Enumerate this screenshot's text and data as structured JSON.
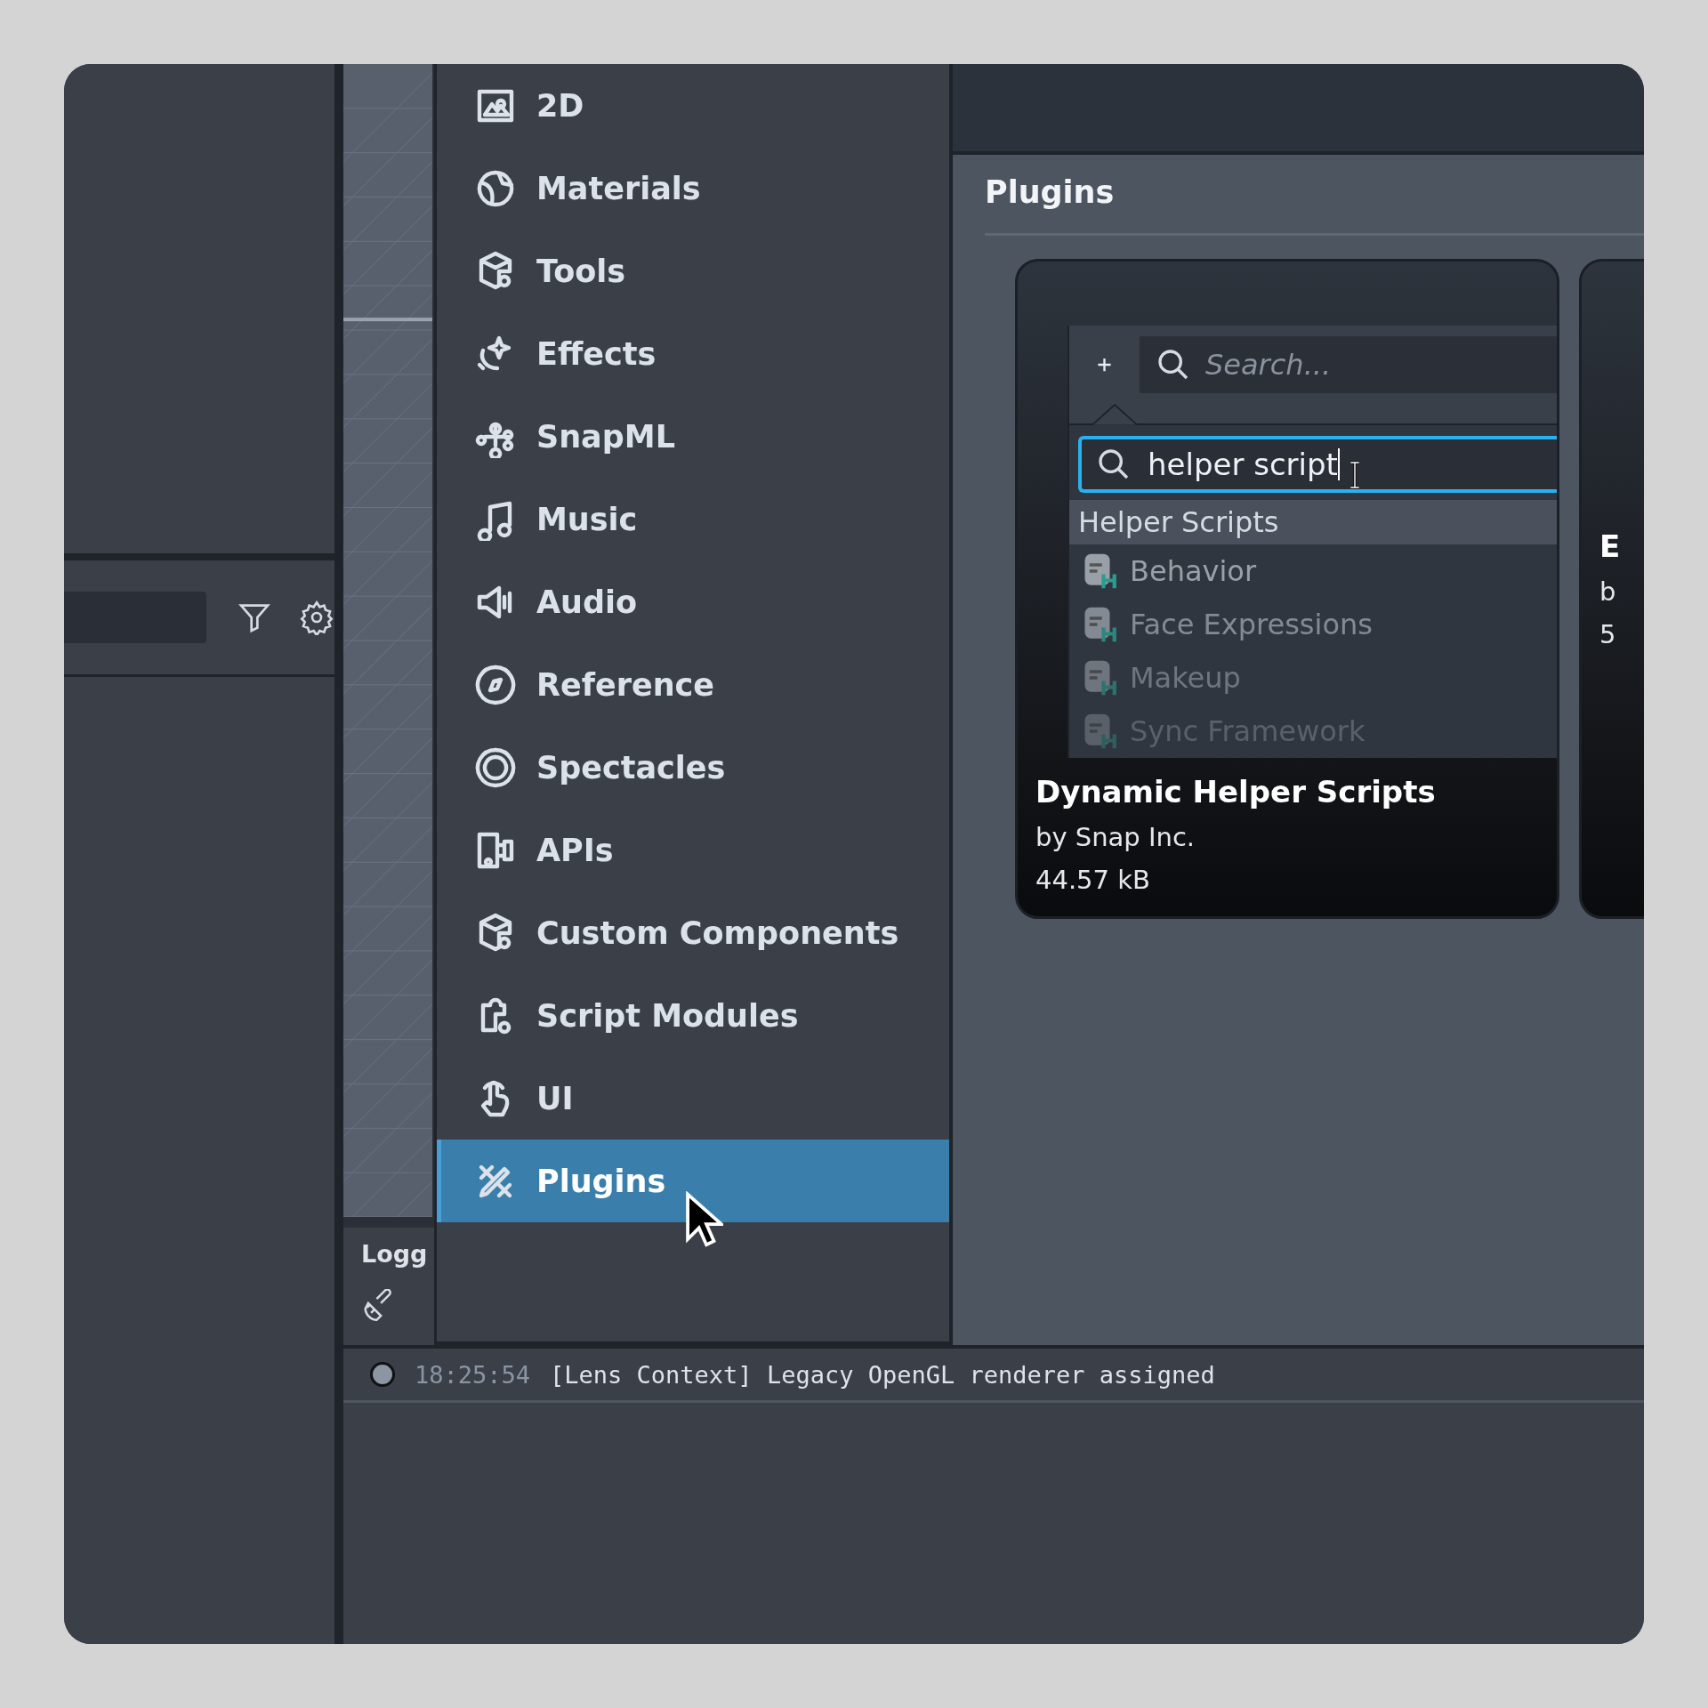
{
  "logger": {
    "title": "Logg"
  },
  "menu": {
    "items": [
      {
        "label": "2D",
        "selected": false
      },
      {
        "label": "Materials",
        "selected": false
      },
      {
        "label": "Tools",
        "selected": false
      },
      {
        "label": "Effects",
        "selected": false
      },
      {
        "label": "SnapML",
        "selected": false
      },
      {
        "label": "Music",
        "selected": false
      },
      {
        "label": "Audio",
        "selected": false
      },
      {
        "label": "Reference",
        "selected": false
      },
      {
        "label": "Spectacles",
        "selected": false
      },
      {
        "label": "APIs",
        "selected": false
      },
      {
        "label": "Custom Components",
        "selected": false
      },
      {
        "label": "Script Modules",
        "selected": false
      },
      {
        "label": "UI",
        "selected": false
      },
      {
        "label": "Plugins",
        "selected": true
      }
    ]
  },
  "content": {
    "title": "Plugins",
    "cards": [
      {
        "title": "Dynamic Helper Scripts",
        "author": "by Snap Inc.",
        "size": "44.57 kB",
        "thumbnail": {
          "search_placeholder": "Search...",
          "query": "helper script",
          "group": "Helper Scripts",
          "items": [
            "Behavior",
            "Face Expressions",
            "Makeup",
            "Sync Framework"
          ]
        }
      },
      {
        "title": "E",
        "author": "b",
        "size": "5"
      }
    ]
  },
  "log": [
    {
      "time": "18:25:54",
      "message": "[Lens Context] Legacy OpenGL renderer assigned"
    }
  ]
}
